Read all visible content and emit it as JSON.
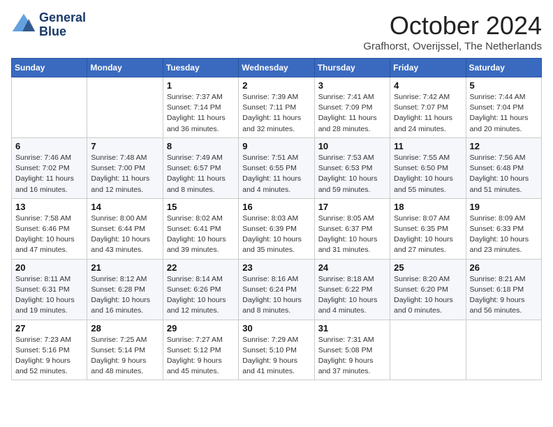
{
  "header": {
    "logo_line1": "General",
    "logo_line2": "Blue",
    "month_title": "October 2024",
    "location": "Grafhorst, Overijssel, The Netherlands"
  },
  "days_of_week": [
    "Sunday",
    "Monday",
    "Tuesday",
    "Wednesday",
    "Thursday",
    "Friday",
    "Saturday"
  ],
  "weeks": [
    [
      {
        "day": "",
        "info": ""
      },
      {
        "day": "",
        "info": ""
      },
      {
        "day": "1",
        "info": "Sunrise: 7:37 AM\nSunset: 7:14 PM\nDaylight: 11 hours\nand 36 minutes."
      },
      {
        "day": "2",
        "info": "Sunrise: 7:39 AM\nSunset: 7:11 PM\nDaylight: 11 hours\nand 32 minutes."
      },
      {
        "day": "3",
        "info": "Sunrise: 7:41 AM\nSunset: 7:09 PM\nDaylight: 11 hours\nand 28 minutes."
      },
      {
        "day": "4",
        "info": "Sunrise: 7:42 AM\nSunset: 7:07 PM\nDaylight: 11 hours\nand 24 minutes."
      },
      {
        "day": "5",
        "info": "Sunrise: 7:44 AM\nSunset: 7:04 PM\nDaylight: 11 hours\nand 20 minutes."
      }
    ],
    [
      {
        "day": "6",
        "info": "Sunrise: 7:46 AM\nSunset: 7:02 PM\nDaylight: 11 hours\nand 16 minutes."
      },
      {
        "day": "7",
        "info": "Sunrise: 7:48 AM\nSunset: 7:00 PM\nDaylight: 11 hours\nand 12 minutes."
      },
      {
        "day": "8",
        "info": "Sunrise: 7:49 AM\nSunset: 6:57 PM\nDaylight: 11 hours\nand 8 minutes."
      },
      {
        "day": "9",
        "info": "Sunrise: 7:51 AM\nSunset: 6:55 PM\nDaylight: 11 hours\nand 4 minutes."
      },
      {
        "day": "10",
        "info": "Sunrise: 7:53 AM\nSunset: 6:53 PM\nDaylight: 10 hours\nand 59 minutes."
      },
      {
        "day": "11",
        "info": "Sunrise: 7:55 AM\nSunset: 6:50 PM\nDaylight: 10 hours\nand 55 minutes."
      },
      {
        "day": "12",
        "info": "Sunrise: 7:56 AM\nSunset: 6:48 PM\nDaylight: 10 hours\nand 51 minutes."
      }
    ],
    [
      {
        "day": "13",
        "info": "Sunrise: 7:58 AM\nSunset: 6:46 PM\nDaylight: 10 hours\nand 47 minutes."
      },
      {
        "day": "14",
        "info": "Sunrise: 8:00 AM\nSunset: 6:44 PM\nDaylight: 10 hours\nand 43 minutes."
      },
      {
        "day": "15",
        "info": "Sunrise: 8:02 AM\nSunset: 6:41 PM\nDaylight: 10 hours\nand 39 minutes."
      },
      {
        "day": "16",
        "info": "Sunrise: 8:03 AM\nSunset: 6:39 PM\nDaylight: 10 hours\nand 35 minutes."
      },
      {
        "day": "17",
        "info": "Sunrise: 8:05 AM\nSunset: 6:37 PM\nDaylight: 10 hours\nand 31 minutes."
      },
      {
        "day": "18",
        "info": "Sunrise: 8:07 AM\nSunset: 6:35 PM\nDaylight: 10 hours\nand 27 minutes."
      },
      {
        "day": "19",
        "info": "Sunrise: 8:09 AM\nSunset: 6:33 PM\nDaylight: 10 hours\nand 23 minutes."
      }
    ],
    [
      {
        "day": "20",
        "info": "Sunrise: 8:11 AM\nSunset: 6:31 PM\nDaylight: 10 hours\nand 19 minutes."
      },
      {
        "day": "21",
        "info": "Sunrise: 8:12 AM\nSunset: 6:28 PM\nDaylight: 10 hours\nand 16 minutes."
      },
      {
        "day": "22",
        "info": "Sunrise: 8:14 AM\nSunset: 6:26 PM\nDaylight: 10 hours\nand 12 minutes."
      },
      {
        "day": "23",
        "info": "Sunrise: 8:16 AM\nSunset: 6:24 PM\nDaylight: 10 hours\nand 8 minutes."
      },
      {
        "day": "24",
        "info": "Sunrise: 8:18 AM\nSunset: 6:22 PM\nDaylight: 10 hours\nand 4 minutes."
      },
      {
        "day": "25",
        "info": "Sunrise: 8:20 AM\nSunset: 6:20 PM\nDaylight: 10 hours\nand 0 minutes."
      },
      {
        "day": "26",
        "info": "Sunrise: 8:21 AM\nSunset: 6:18 PM\nDaylight: 9 hours\nand 56 minutes."
      }
    ],
    [
      {
        "day": "27",
        "info": "Sunrise: 7:23 AM\nSunset: 5:16 PM\nDaylight: 9 hours\nand 52 minutes."
      },
      {
        "day": "28",
        "info": "Sunrise: 7:25 AM\nSunset: 5:14 PM\nDaylight: 9 hours\nand 48 minutes."
      },
      {
        "day": "29",
        "info": "Sunrise: 7:27 AM\nSunset: 5:12 PM\nDaylight: 9 hours\nand 45 minutes."
      },
      {
        "day": "30",
        "info": "Sunrise: 7:29 AM\nSunset: 5:10 PM\nDaylight: 9 hours\nand 41 minutes."
      },
      {
        "day": "31",
        "info": "Sunrise: 7:31 AM\nSunset: 5:08 PM\nDaylight: 9 hours\nand 37 minutes."
      },
      {
        "day": "",
        "info": ""
      },
      {
        "day": "",
        "info": ""
      }
    ]
  ]
}
